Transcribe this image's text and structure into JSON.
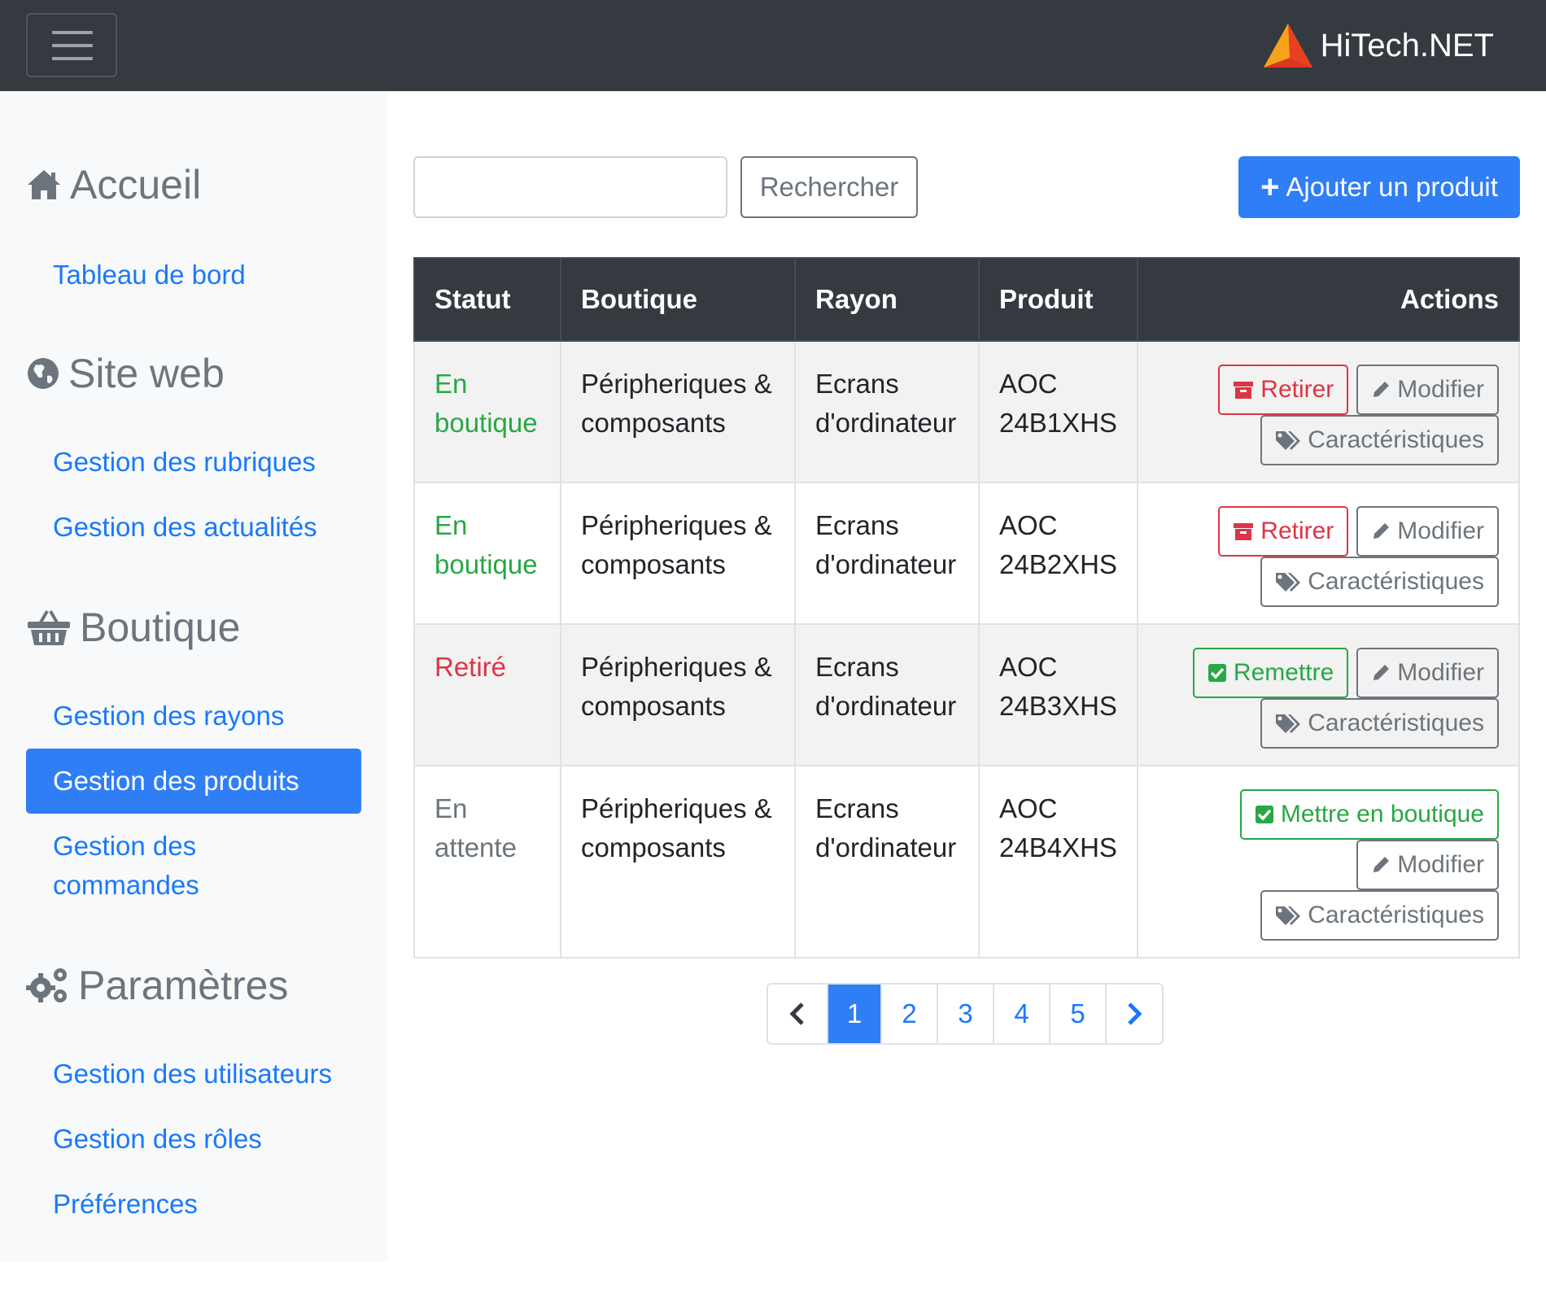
{
  "navbar": {
    "brand": "HiTech.NET"
  },
  "sidebar": {
    "sections": [
      {
        "heading": "Accueil",
        "icon": "home-icon",
        "items": [
          "Tableau de bord"
        ]
      },
      {
        "heading": "Site web",
        "icon": "globe-icon",
        "items": [
          "Gestion des rubriques",
          "Gestion des actualités"
        ]
      },
      {
        "heading": "Boutique",
        "icon": "basket-icon",
        "items": [
          "Gestion des rayons",
          "Gestion des produits",
          "Gestion des commandes"
        ]
      },
      {
        "heading": "Paramètres",
        "icon": "gears-icon",
        "items": [
          "Gestion des utilisateurs",
          "Gestion des rôles",
          "Préférences"
        ]
      }
    ],
    "active_item": "Gestion des produits",
    "commandes_line1": "Gestion des",
    "commandes_line2": "commandes"
  },
  "toolbar": {
    "search_value": "",
    "search_button": "Rechercher",
    "add_button": "Ajouter un produit"
  },
  "table": {
    "headers": [
      "Statut",
      "Boutique",
      "Rayon",
      "Produit",
      "Actions"
    ],
    "rows": [
      {
        "statut_1": "En",
        "statut_2": "boutique",
        "boutique_1": "Péripheriques &",
        "boutique_2": "composants",
        "rayon_1": "Ecrans",
        "rayon_2": "d'ordinateur",
        "produit_1": "AOC",
        "produit_2": "24B1XHS",
        "primary_action": "Retirer",
        "edit": "Modifier",
        "specs": "Caractéristiques"
      },
      {
        "statut_1": "En",
        "statut_2": "boutique",
        "boutique_1": "Péripheriques &",
        "boutique_2": "composants",
        "rayon_1": "Ecrans",
        "rayon_2": "d'ordinateur",
        "produit_1": "AOC",
        "produit_2": "24B2XHS",
        "primary_action": "Retirer",
        "edit": "Modifier",
        "specs": "Caractéristiques"
      },
      {
        "statut_1": "Retiré",
        "statut_2": "",
        "boutique_1": "Péripheriques &",
        "boutique_2": "composants",
        "rayon_1": "Ecrans",
        "rayon_2": "d'ordinateur",
        "produit_1": "AOC",
        "produit_2": "24B3XHS",
        "primary_action": "Remettre",
        "edit": "Modifier",
        "specs": "Caractéristiques"
      },
      {
        "statut_1": "En",
        "statut_2": "attente",
        "boutique_1": "Péripheriques &",
        "boutique_2": "composants",
        "rayon_1": "Ecrans",
        "rayon_2": "d'ordinateur",
        "produit_1": "AOC",
        "produit_2": "24B4XHS",
        "primary_action": "Mettre en boutique",
        "edit": "Modifier",
        "specs": "Caractéristiques"
      }
    ]
  },
  "pagination": {
    "pages": [
      "1",
      "2",
      "3",
      "4",
      "5"
    ],
    "current": "1"
  },
  "colors": {
    "navbar": "#343a40",
    "primary": "#2f7ef6",
    "link": "#1a79fa",
    "success": "#28a745",
    "danger": "#dc3545",
    "secondary": "#6c757d"
  }
}
